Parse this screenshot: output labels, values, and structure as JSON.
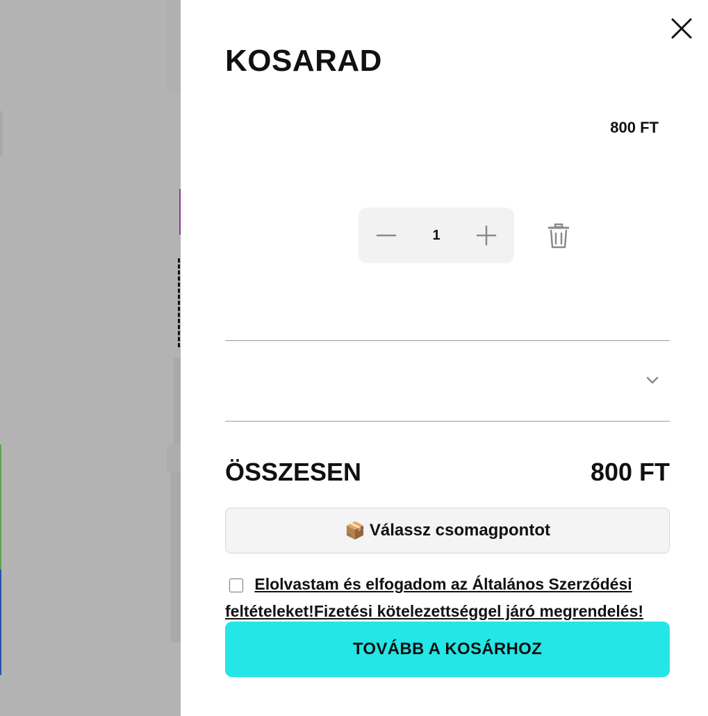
{
  "cart": {
    "title": "KOSARAD",
    "item": {
      "price": "800 FT",
      "quantity": "1"
    },
    "summary": {
      "total_label": "ÖSSZESEN",
      "total_value": "800 FT"
    },
    "pickup_button": {
      "icon": "📦",
      "label": "Válassz csomagpontot"
    },
    "terms": {
      "text": "Elolvastam és elfogadom az Általános Szerződési feltételeket!Fizetési kötelezettséggel járó megrendelés!",
      "checked": false
    },
    "checkout_label": "TOVÁBB A KOSÁRHOZ"
  },
  "colors": {
    "overlay": "#b3b3b3",
    "checkout_button": "#25e6e6",
    "pickup_button": "#f4f4f4"
  },
  "icons": [
    "close-icon",
    "minus-icon",
    "plus-icon",
    "trash-icon",
    "chevron-down-icon",
    "package-icon"
  ]
}
